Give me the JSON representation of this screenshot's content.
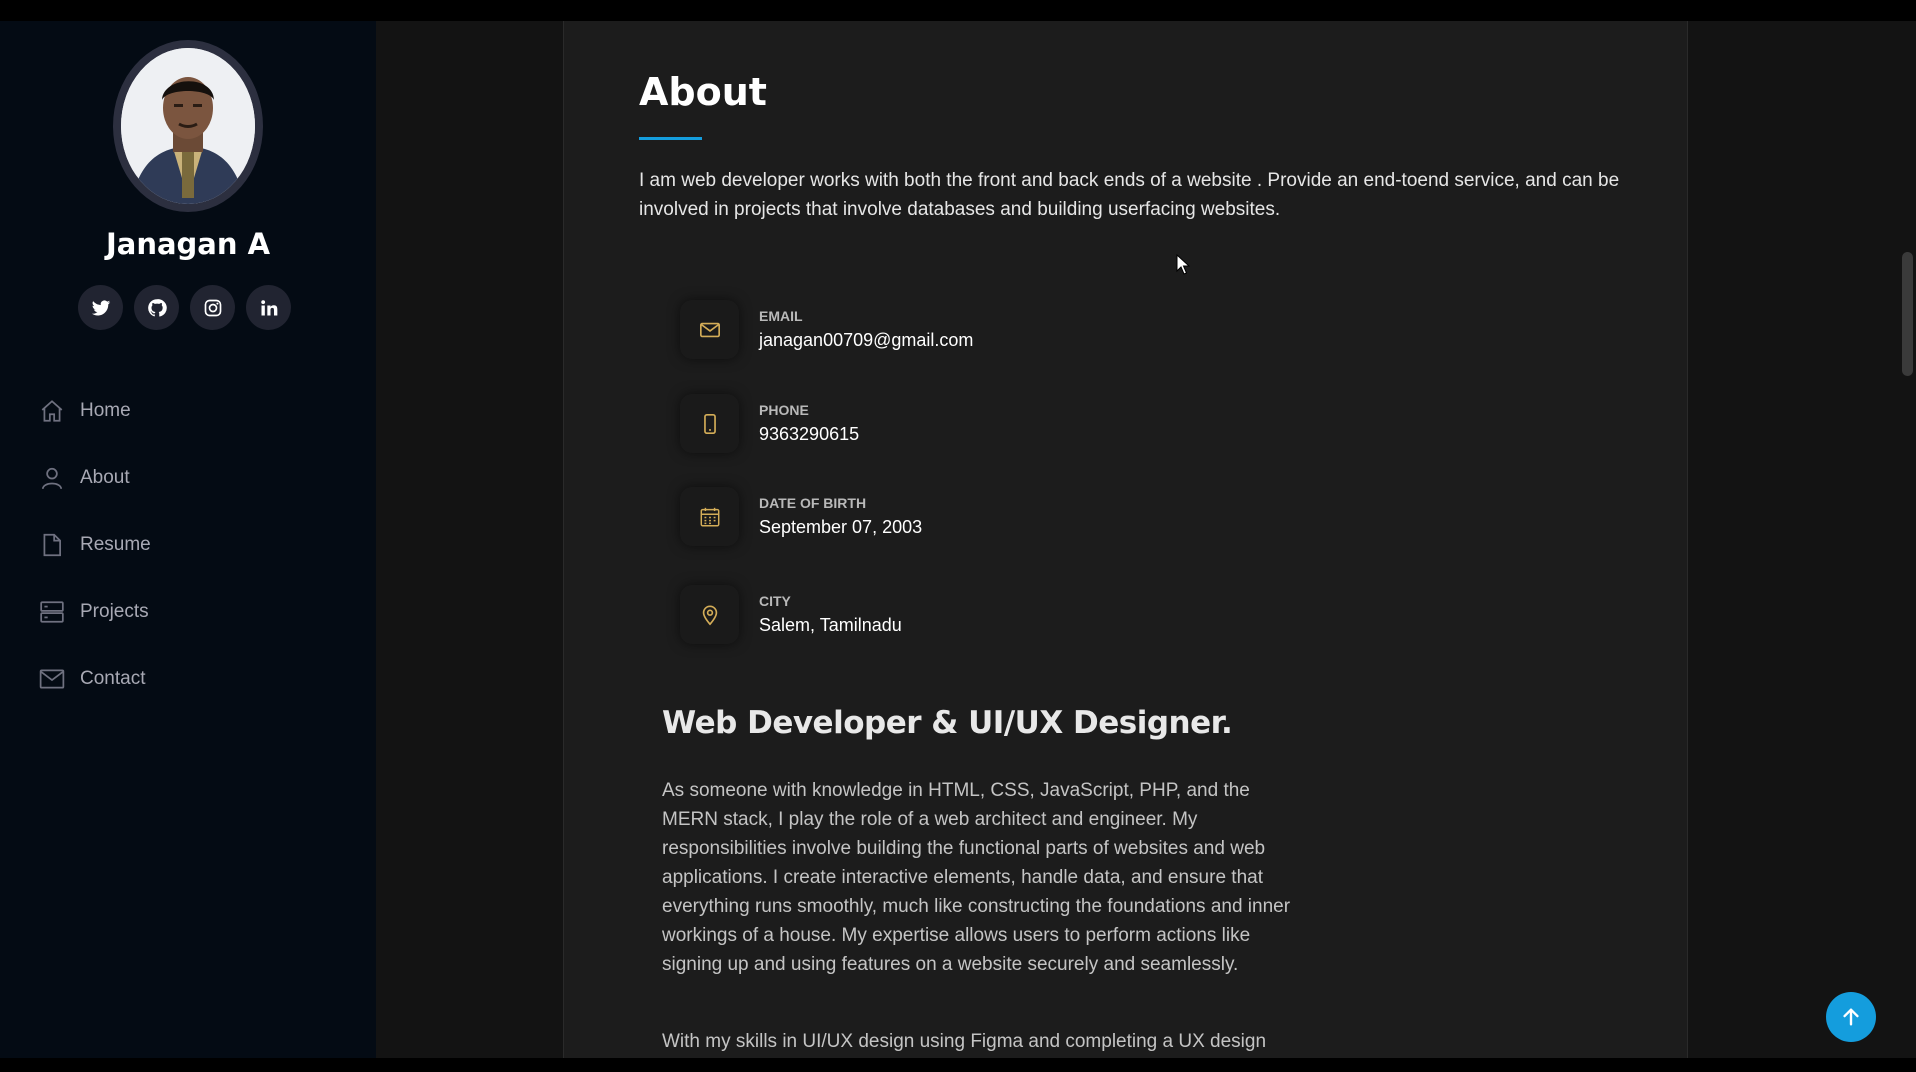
{
  "profile": {
    "name": "Janagan A",
    "socials": [
      "twitter-icon",
      "github-icon",
      "instagram-icon",
      "linkedin-icon"
    ]
  },
  "nav": {
    "items": [
      {
        "label": "Home",
        "icon": "home-icon"
      },
      {
        "label": "About",
        "icon": "person-icon"
      },
      {
        "label": "Resume",
        "icon": "file-icon"
      },
      {
        "label": "Projects",
        "icon": "server-icon"
      },
      {
        "label": "Contact",
        "icon": "envelope-icon"
      }
    ]
  },
  "about": {
    "title": "About",
    "intro": "I am web developer works with both the front and back ends of a website . Provide an end-toend service, and can be involved in projects that involve databases and building userfacing websites.",
    "info": [
      {
        "label": "EMAIL",
        "value": "janagan00709@gmail.com",
        "icon": "envelope-icon"
      },
      {
        "label": "PHONE",
        "value": "9363290615",
        "icon": "phone-icon"
      },
      {
        "label": "DATE OF BIRTH",
        "value": "September 07, 2003",
        "icon": "calendar-icon"
      },
      {
        "label": "CITY",
        "value": "Salem, Tamilnadu",
        "icon": "map-pin-icon"
      }
    ],
    "role_title": "Web Developer & UI/UX Designer.",
    "role_desc": "As someone with knowledge in HTML, CSS, JavaScript, PHP, and the MERN stack, I play the role of a web architect and engineer. My responsibilities involve building the functional parts of websites and web applications. I create interactive elements, handle data, and ensure that everything runs smoothly, much like constructing the foundations and inner workings of a house. My expertise allows users to perform actions like signing up and using features on a website securely and seamlessly.",
    "role_desc2": "With my skills in UI/UX design using Figma and completing a UX design"
  },
  "colors": {
    "accent": "#149ddd",
    "icon_gold": "#d4ad58",
    "sidebar_bg": "#040b14",
    "content_bg": "#1c1c1c"
  }
}
